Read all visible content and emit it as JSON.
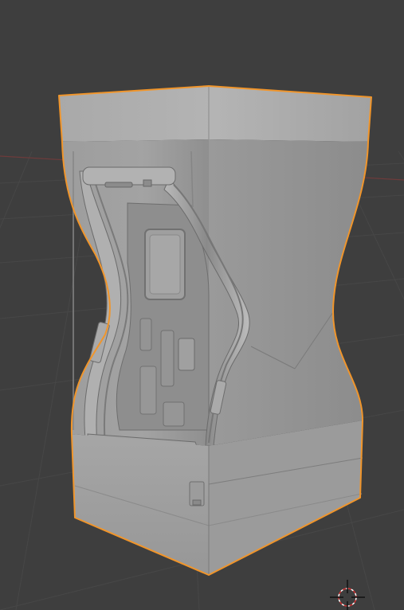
{
  "viewport": {
    "background_color": "#3e3e3e",
    "grid_color": "#4a4a4a",
    "x_axis_color": "#7a3a3a",
    "selection_outline_color": "#f0952b",
    "model_base_color": "#9a9a9a"
  },
  "scene": {
    "object": "sci-fi-door-pillar",
    "selected": true,
    "shading": "solid"
  },
  "cursor": {
    "icon": "3d-cursor-icon"
  }
}
